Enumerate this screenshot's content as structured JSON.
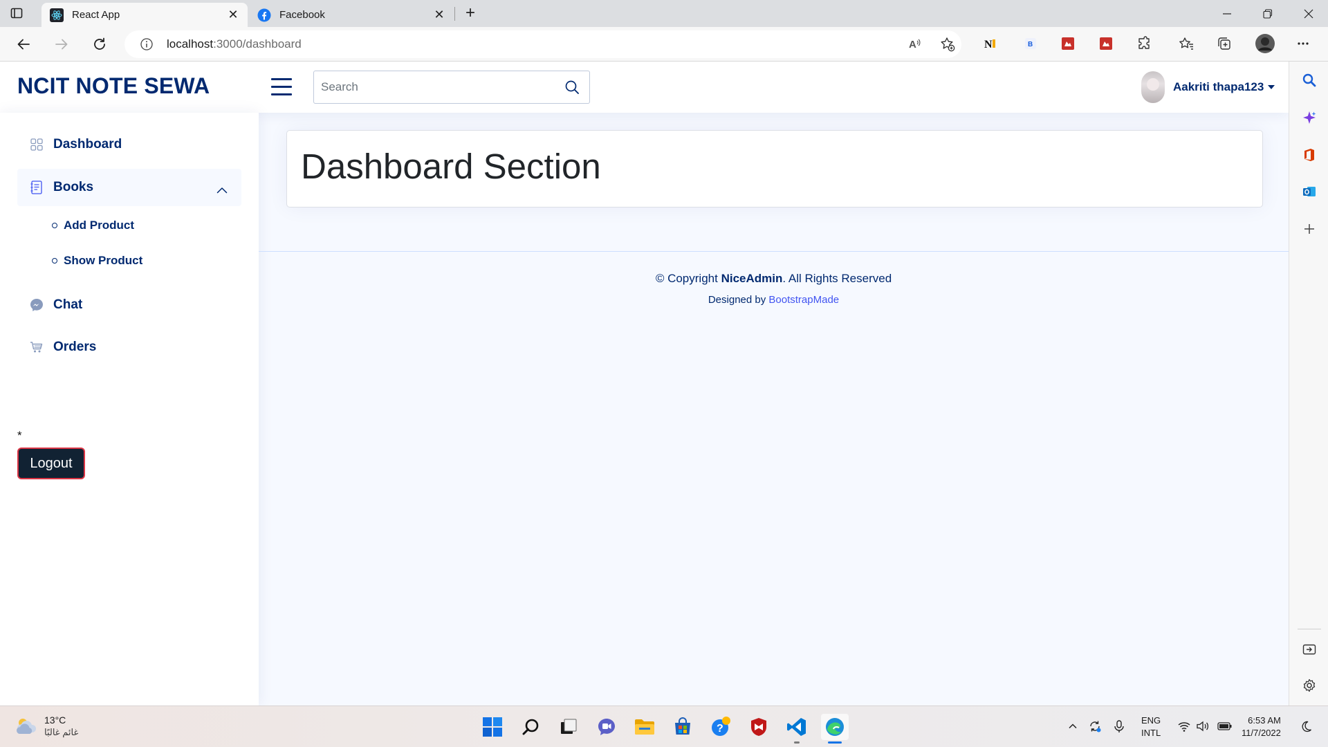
{
  "browser": {
    "tabs": [
      {
        "label": "React App",
        "icon": "react-icon",
        "active": true
      },
      {
        "label": "Facebook",
        "icon": "facebook-icon",
        "active": false
      }
    ],
    "tab_close": "✕",
    "new_tab": "+",
    "url": {
      "host": "localhost",
      "path": ":3000/dashboard"
    },
    "extensions": [
      "read-aloud-icon",
      "favorite-add-icon",
      "notion-web-clipper-icon",
      "bitwarden-icon",
      "red-extension-icon",
      "red-extension-icon-2",
      "extensions-puzzle-icon",
      "favorites-icon",
      "collections-icon",
      "profile-avatar-icon",
      "more-icon"
    ],
    "window_controls": {
      "minimize": "—",
      "restore": "❐",
      "close": "✕"
    },
    "sidebar_tools": [
      "search-icon",
      "copilot-icon",
      "office-icon",
      "outlook-icon",
      "add-icon",
      "hide-sidebar-icon",
      "settings-icon"
    ]
  },
  "app": {
    "logo": "NCIT NOTE SEWA",
    "search": {
      "placeholder": "Search"
    },
    "profile": {
      "name": "Aakriti thapa123"
    },
    "sidebar": {
      "dashboard": "Dashboard",
      "books": "Books",
      "add_product": "Add Product",
      "show_product": "Show Product",
      "chat": "Chat",
      "orders": "Orders",
      "marker": "*",
      "logout": "Logout"
    },
    "main": {
      "title": "Dashboard Section"
    },
    "footer": {
      "copyright_prefix": "© Copyright ",
      "brand": "NiceAdmin",
      "copyright_suffix": ". All Rights Reserved",
      "designed_by": "Designed by ",
      "designer": "BootstrapMade"
    }
  },
  "taskbar": {
    "weather": {
      "temp": "13°C",
      "desc": "غائم غالبًا"
    },
    "apps": [
      "windows-start-icon",
      "search-icon",
      "task-view-icon",
      "teams-chat-icon",
      "file-explorer-icon",
      "microsoft-store-icon",
      "get-help-icon",
      "mcafee-icon",
      "vscode-icon",
      "edge-icon"
    ],
    "lang": {
      "line1": "ENG",
      "line2": "INTL"
    },
    "clock": {
      "time": "6:53 AM",
      "date": "11/7/2022"
    }
  },
  "colors": {
    "brand": "#012970",
    "accent": "#4154f1",
    "logout_bg": "#112233",
    "logout_border": "#dc3545",
    "app_bg": "#f6f9ff"
  }
}
